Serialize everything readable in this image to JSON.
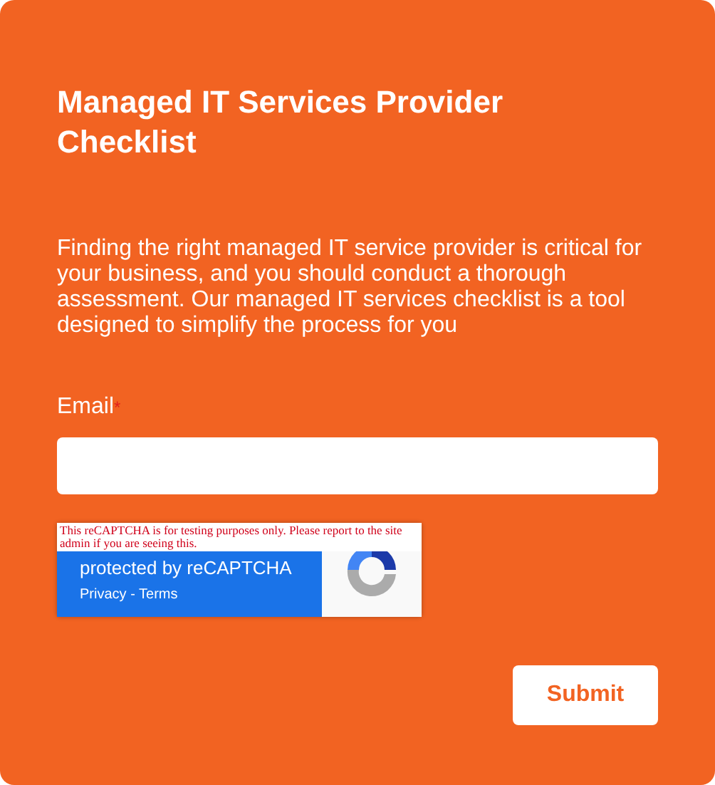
{
  "form": {
    "title": "Managed IT Services Provider Checklist",
    "description": "Finding the right managed IT service provider is critical for your business, and you should conduct a thorough assessment. Our managed IT services checklist is a tool designed to simplify the process for you",
    "fields": [
      {
        "label": "Email",
        "required": true,
        "required_mark": "*"
      }
    ],
    "recaptcha": {
      "warning": "This reCAPTCHA is for testing purposes only. Please report to the site admin if you are seeing this.",
      "title": "protected by reCAPTCHA",
      "privacy": "Privacy",
      "separator": " - ",
      "terms": "Terms"
    },
    "submit": "Submit"
  }
}
